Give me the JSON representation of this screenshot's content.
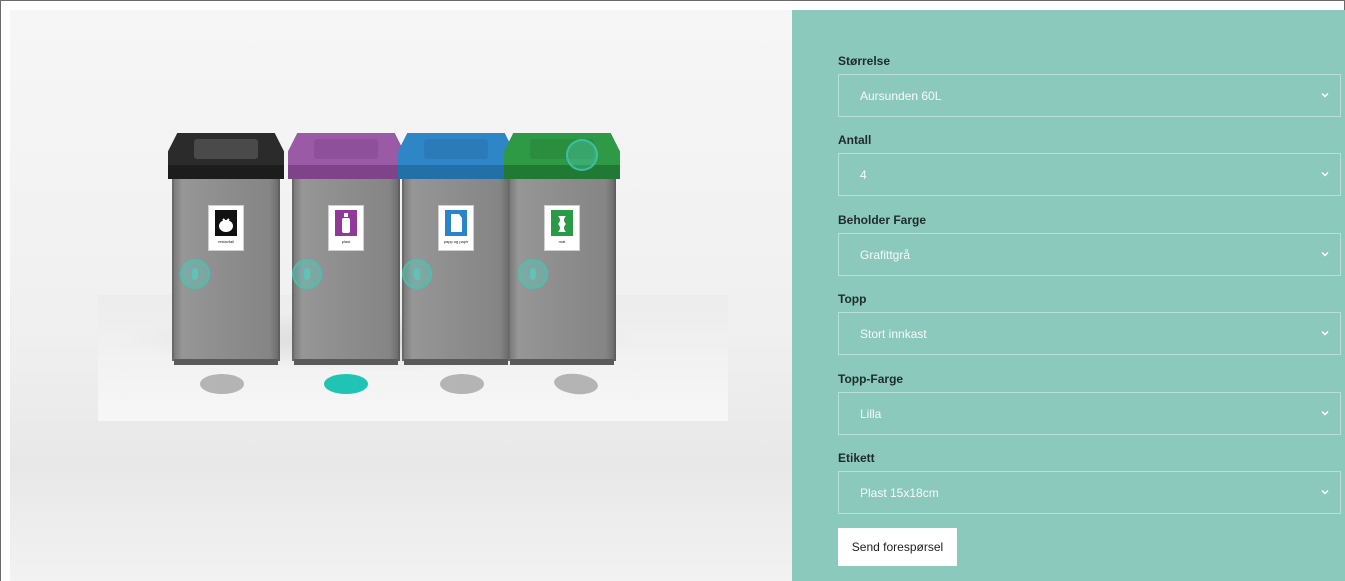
{
  "viewer": {
    "bins": [
      {
        "lid_color": "#2b2b2b",
        "opening_color": "#4a4a4a",
        "label_color": "#111111",
        "label_text": "restavfall",
        "icon": "trash-bag-icon",
        "selected": false
      },
      {
        "lid_color": "#9a5aa6",
        "opening_color": "#8e4f9b",
        "label_color": "#8e3a96",
        "label_text": "plast",
        "icon": "bottle-icon",
        "selected": true
      },
      {
        "lid_color": "#2f86c6",
        "opening_color": "#2b7bb8",
        "label_color": "#2a84c8",
        "label_text": "papp og papir",
        "icon": "paper-icon",
        "selected": false
      },
      {
        "lid_color": "#2e9a45",
        "opening_color": "#2b8e3f",
        "label_color": "#2a9a47",
        "label_text": "mat",
        "icon": "apple-core-icon",
        "selected": false
      }
    ],
    "accent_color": "#20c4b4"
  },
  "form": {
    "fields": [
      {
        "label": "Størrelse",
        "value": "Aursunden 60L"
      },
      {
        "label": "Antall",
        "value": "4"
      },
      {
        "label": "Beholder Farge",
        "value": "Grafittgrå"
      },
      {
        "label": "Topp",
        "value": "Stort innkast"
      },
      {
        "label": "Topp-Farge",
        "value": "Lilla"
      },
      {
        "label": "Etikett",
        "value": "Plast 15x18cm"
      }
    ],
    "submit_label": "Send forespørsel"
  },
  "colors": {
    "panel_bg": "#8cc9bd"
  }
}
